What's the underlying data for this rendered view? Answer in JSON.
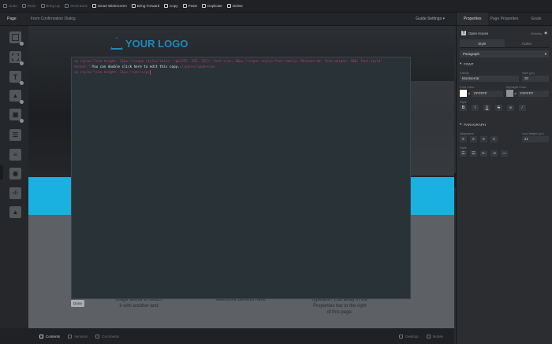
{
  "toolbar": {
    "items": [
      {
        "label": "Undo",
        "active": false
      },
      {
        "label": "Redo",
        "active": false
      },
      {
        "label": "Bring Up",
        "active": false
      },
      {
        "label": "Send Back",
        "active": false
      },
      {
        "label": "Smart Widescreen",
        "active": true
      },
      {
        "label": "Bring Forward",
        "active": true
      },
      {
        "label": "Copy",
        "active": true
      },
      {
        "label": "Paste",
        "active": true
      },
      {
        "label": "Duplicate",
        "active": true
      },
      {
        "label": "Delete",
        "active": true
      }
    ]
  },
  "tabs": {
    "page": "Page",
    "dialog": "Form Confirmation Dialog",
    "guide_settings": "Guide Settings"
  },
  "canvas": {
    "logo_text": "YOUR LOGO",
    "text_left": "image above to switch\nit with another and",
    "text_mid": "awesome benefits here.",
    "text_right": "typeface? Edit away in the\nProperties bar to the right\nof this page."
  },
  "code_editor": {
    "line1_open": "<p style=\"line-height: 21px;\"><span style=\"color: rgb(255, 255, 255); font-size: 20px;\"><span style=\"font-family: Montserrat; font-weight: 400; font-style: normal;\">",
    "line1_text": "You can double click here to edit this copy.",
    "line1_close": "</span></span></p>",
    "line2": "<p style=\"line-height: 21px;\"><br></p>",
    "done_label": "Done"
  },
  "bottom_bar": {
    "contents": "Contents",
    "versions": "Versions",
    "comments": "Comments",
    "desktop": "Desktop",
    "mobile": "Mobile"
  },
  "properties": {
    "tabs": [
      "Properties",
      "Page Properties",
      "Goals"
    ],
    "element_name": "Open House",
    "visibility_label": "Visibility",
    "subtabs": [
      "Style",
      "Action"
    ],
    "block_style": "Paragraph",
    "font_section": "FONT",
    "family_label": "Family",
    "family_value": "Montserrat",
    "size_label": "Size (px)",
    "size_value": "20",
    "font_color_label": "Font Color",
    "font_color_value": "FFFFFF",
    "highlight_label": "Highlight Color",
    "highlight_value": "FFFFFF",
    "style_label": "Style",
    "paragraph_section": "PARAGRAPH",
    "alignment_label": "Alignment",
    "line_height_label": "Line height (px)",
    "line_height_value": "21",
    "style2_label": "Style"
  },
  "colors": {
    "accent_cyan": "#1ab0e0",
    "logo_blue": "#1f88b8",
    "editor_bg": "#283237",
    "tag_color": "#c23a6b"
  }
}
